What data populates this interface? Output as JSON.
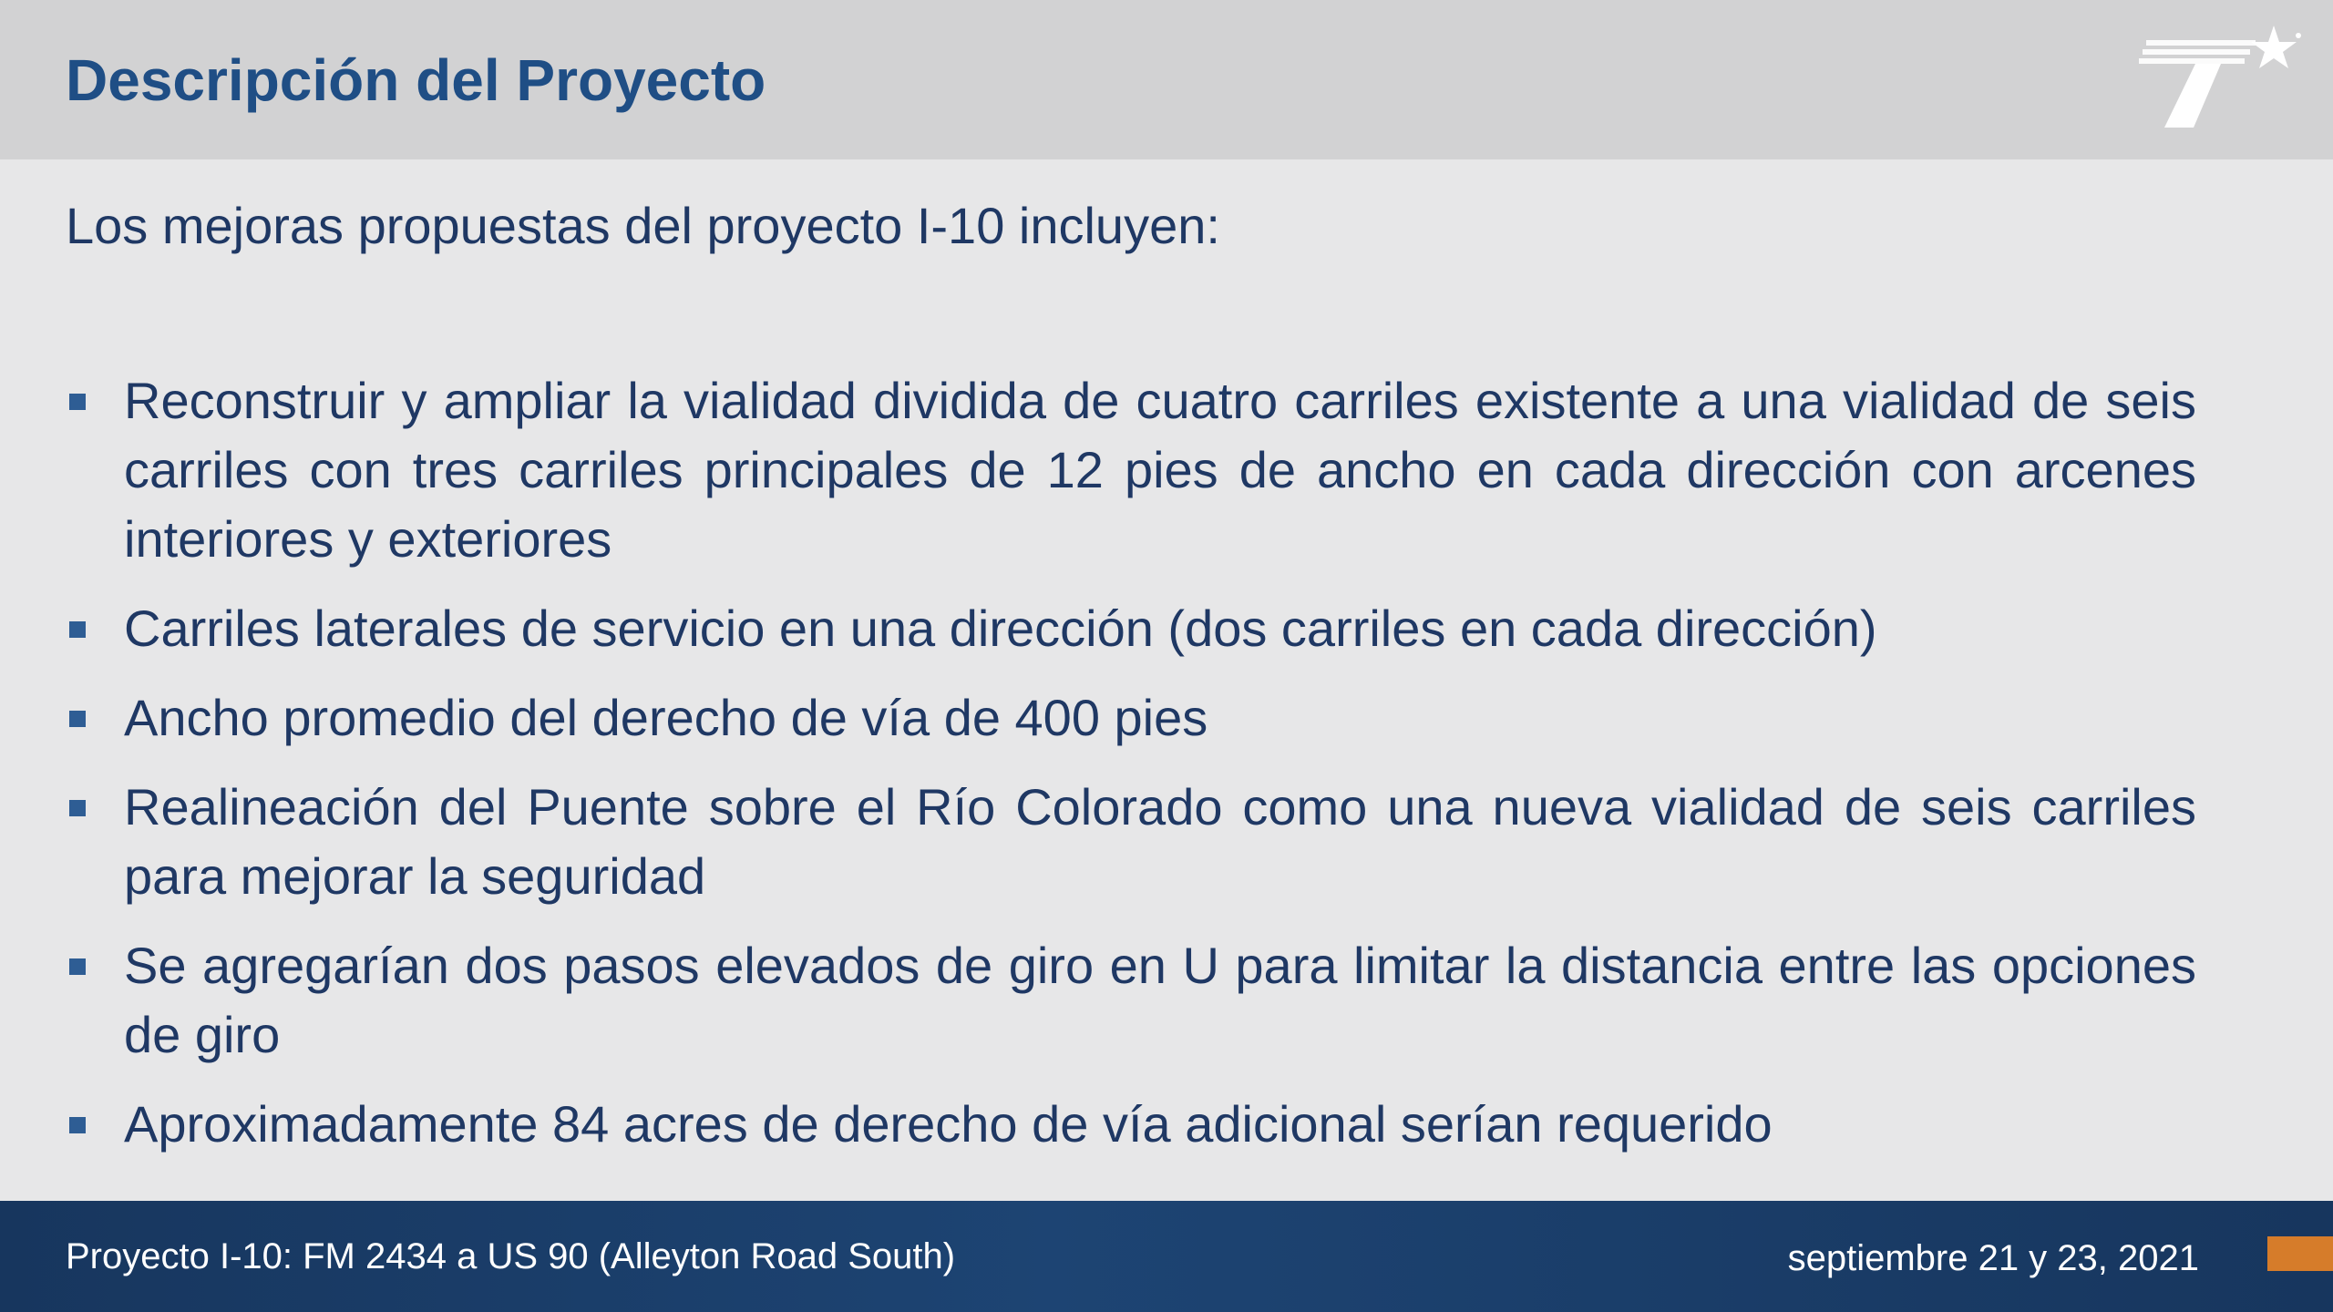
{
  "header": {
    "title": "Descripción del Proyecto",
    "logo_icon": "txdot-star-logo-icon"
  },
  "content": {
    "intro": "Los mejoras propuestas del proyecto I-10 incluyen:",
    "bullets": [
      {
        "text": "Reconstruir y ampliar la vialidad dividida de cuatro carriles existente a una vialidad de seis carriles con tres carriles principales de 12 pies de ancho en cada dirección con arcenes interiores y exteriores"
      },
      {
        "text": "Carriles laterales de servicio en una dirección (dos carriles en cada dirección)"
      },
      {
        "text": "Ancho promedio del derecho de vía de 400 pies"
      },
      {
        "text": "Realineación del Puente sobre el Río Colorado como una nueva vialidad de seis carriles para mejorar la seguridad"
      },
      {
        "text": "Se agregarían dos pasos elevados de giro en U para limitar la distancia entre las opciones de giro"
      },
      {
        "text": "Aproximadamente 84 acres de derecho de vía adicional serían requerido"
      }
    ]
  },
  "footer": {
    "project": "Proyecto I-10: FM 2434 a US 90 (Alleyton Road South)",
    "date": "septiembre 21 y 23, 2021"
  },
  "colors": {
    "title": "#1f4e85",
    "body_text": "#1f3864",
    "header_bg": "#d2d2d3",
    "body_bg": "#e7e7e8",
    "footer_bg": "#1d4473",
    "accent": "#d67c2a"
  }
}
